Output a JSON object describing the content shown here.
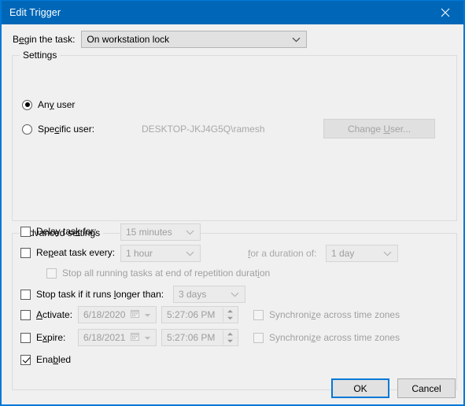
{
  "window": {
    "title": "Edit Trigger",
    "close_icon": "close-icon",
    "accent_color": "#0067b8",
    "face_color": "#f0f0f0"
  },
  "begin": {
    "label_pre": "B",
    "label_underline": "e",
    "label_post": "gin the task:",
    "combo_value": "On workstation lock",
    "chevron_icon": "chevron-down-icon"
  },
  "settings": {
    "title": "Settings",
    "any_user": {
      "pre": "An",
      "underline": "y",
      "post": " user",
      "checked": true
    },
    "specific_user": {
      "pre": "Spe",
      "underline": "c",
      "post": "ific user:",
      "checked": false
    },
    "user_name": "DESKTOP-JKJ4G5Q\\ramesh",
    "change_user_button": {
      "pre": "Change ",
      "underline": "U",
      "post": "ser...",
      "enabled": false
    }
  },
  "advanced": {
    "title": "Advanced settings",
    "delay": {
      "pre": "Delay tas",
      "underline": "k",
      "post": " for:",
      "checked": false,
      "value": "15 minutes"
    },
    "repeat": {
      "pre": "Re",
      "underline": "p",
      "post": "eat task every:",
      "checked": false,
      "value": "1 hour"
    },
    "duration": {
      "pre": "",
      "underline": "f",
      "post": "or a duration of:",
      "value": "1 day"
    },
    "stop_all": {
      "pre": "Stop all running tasks at end of repetition durat",
      "underline": "i",
      "post": "on",
      "checked": false,
      "enabled": false
    },
    "stop_task": {
      "pre": "Stop task if it runs ",
      "underline": "l",
      "post": "onger than:",
      "checked": false,
      "value": "3 days"
    },
    "activate": {
      "pre": "",
      "underline": "A",
      "post": "ctivate:",
      "checked": false,
      "date": "6/18/2020",
      "time": "5:27:06 PM",
      "sync_pre": "Synchroni",
      "sync_underline": "z",
      "sync_post": "e across time zones",
      "sync_checked": false
    },
    "expire": {
      "pre": "E",
      "underline": "x",
      "post": "pire:",
      "checked": false,
      "date": "6/18/2021",
      "time": "5:27:06 PM",
      "sync_pre": "Synchroni",
      "sync_underline": "z",
      "sync_post": "e across time zones",
      "sync_checked": false
    },
    "enabled": {
      "pre": "Ena",
      "underline": "b",
      "post": "led",
      "checked": true
    }
  },
  "footer": {
    "ok_label": "OK",
    "cancel_label": "Cancel"
  }
}
